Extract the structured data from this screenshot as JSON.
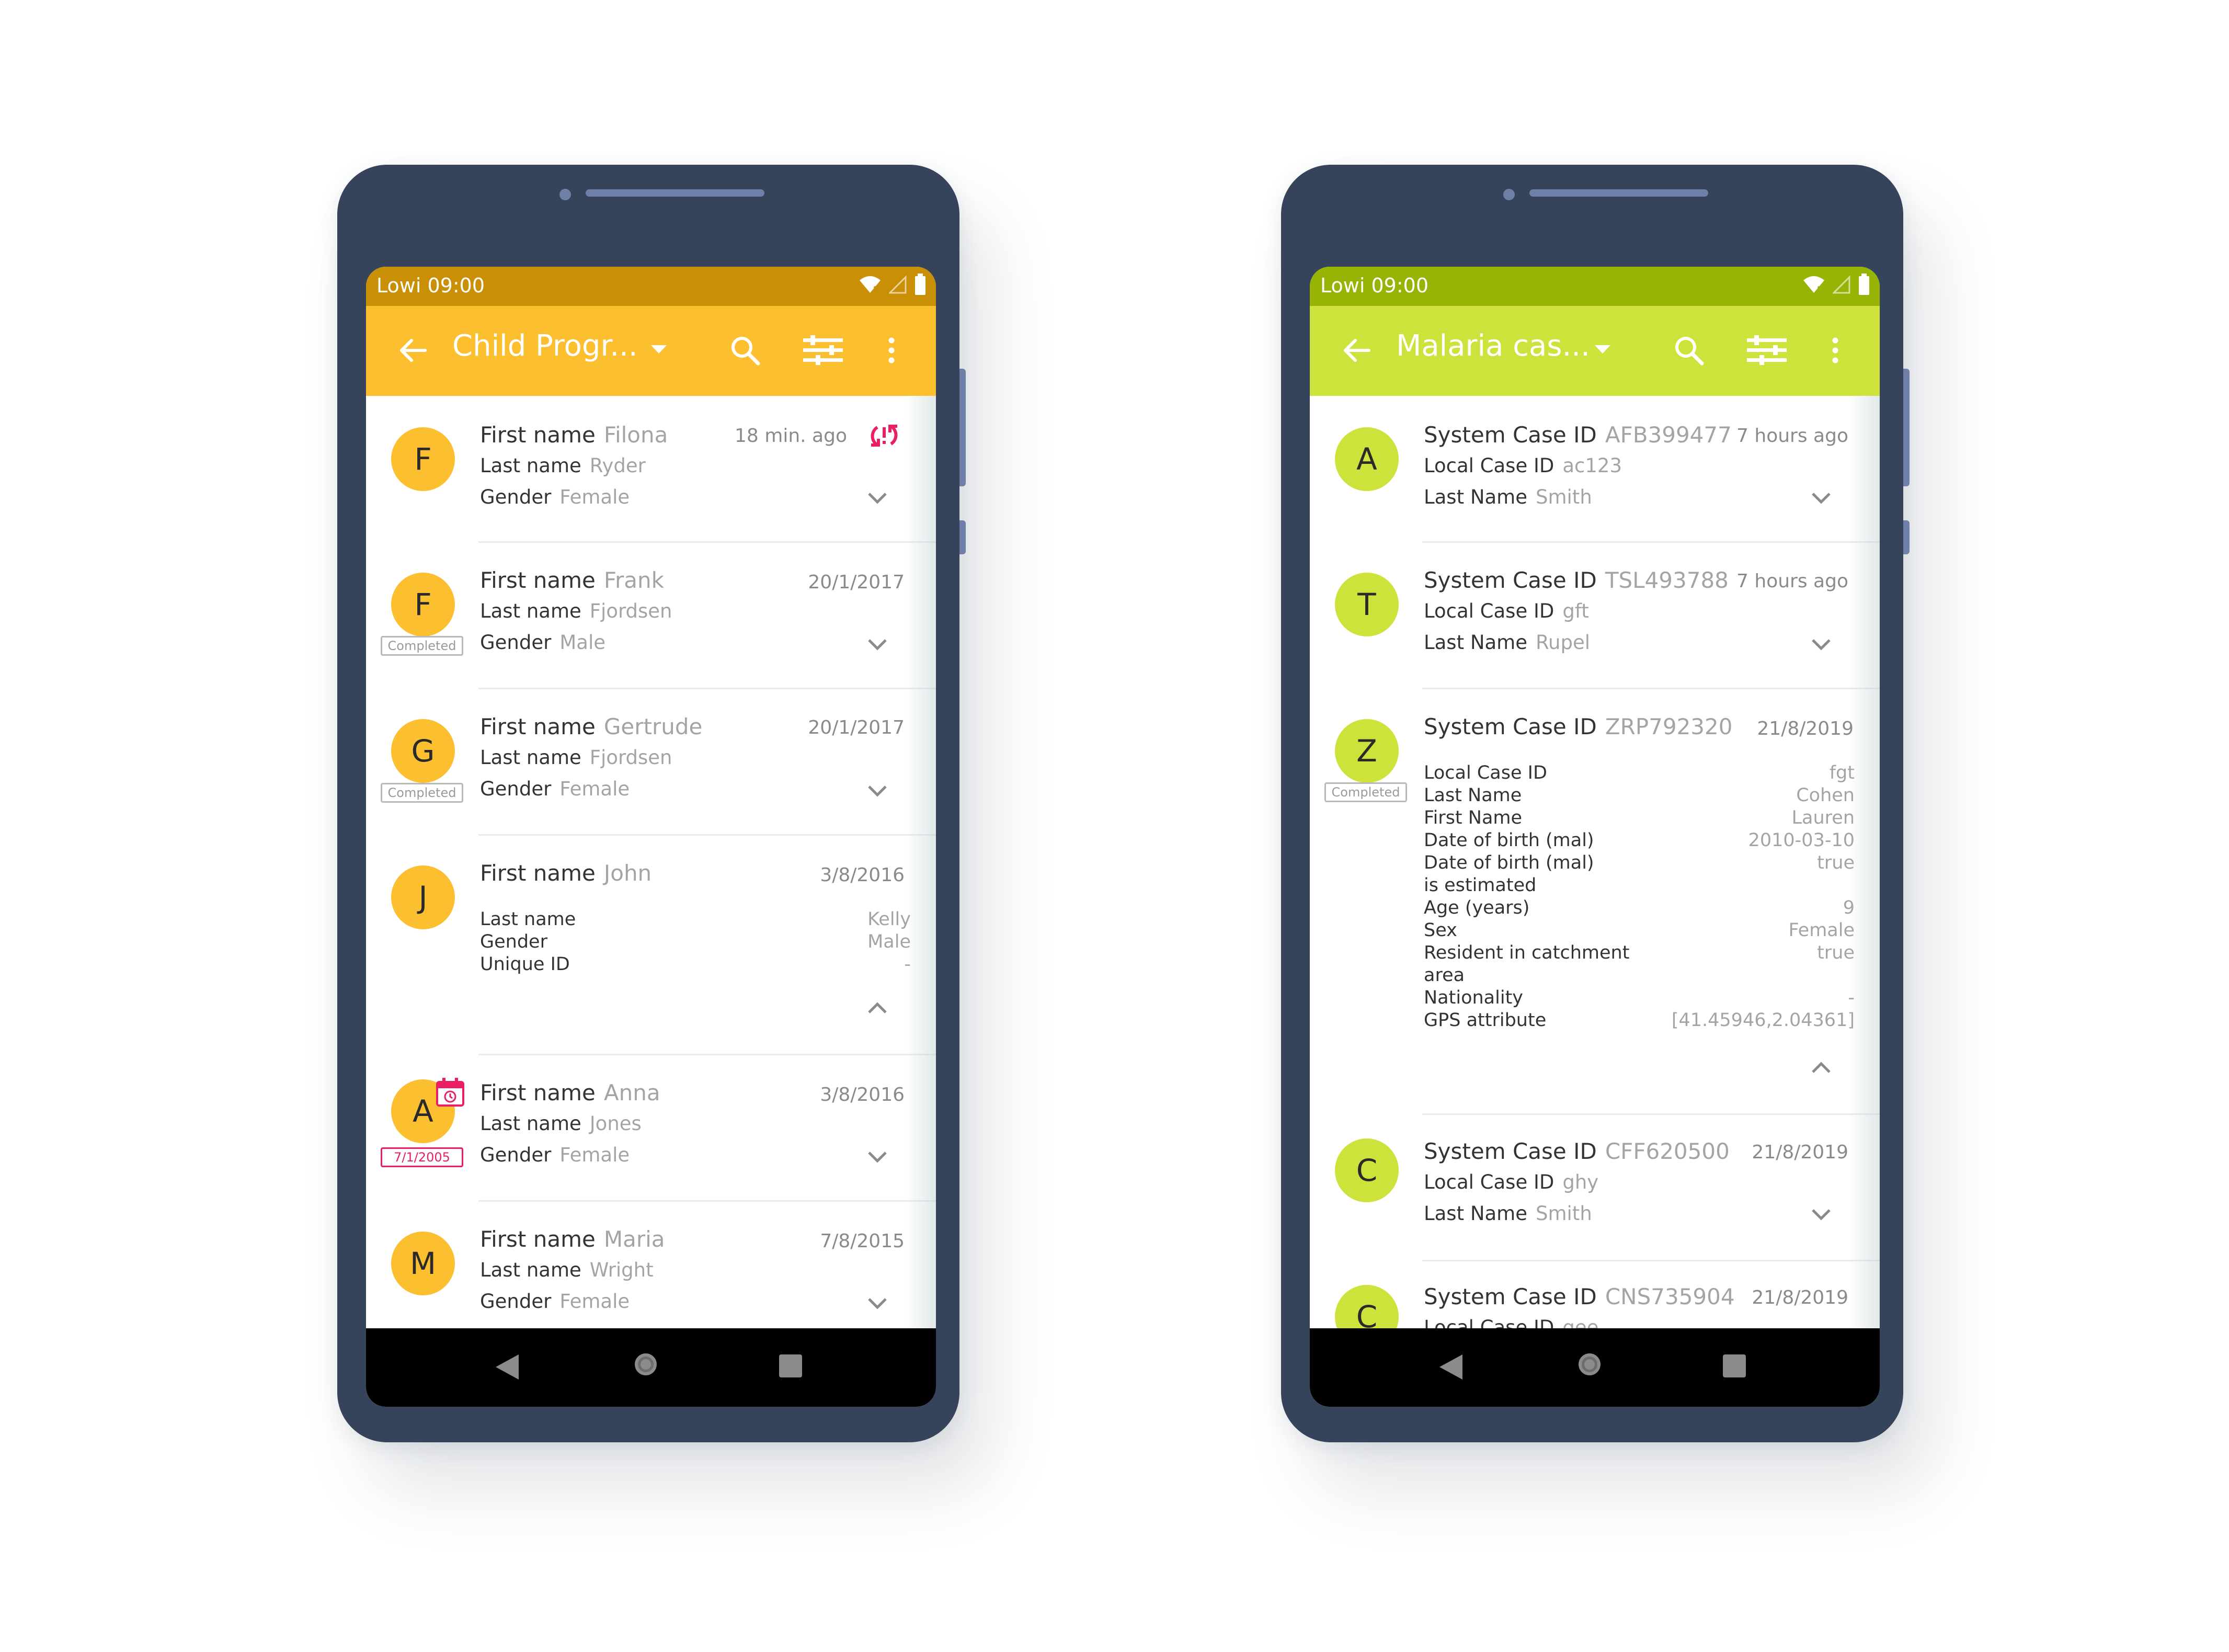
{
  "colors": {
    "left_status": "#c98f05",
    "left_toolbar": "#fbbf30",
    "left_avatar": "#fbbf30",
    "right_status": "#97b405",
    "right_toolbar": "#cde23a",
    "right_avatar": "#cde23a",
    "sync_error": "#e91e63",
    "overdue": "#e91e63"
  },
  "left": {
    "status": {
      "carrier": "Lowi",
      "time": "09:00"
    },
    "toolbar": {
      "title": "Child Progr..."
    },
    "rows": [
      {
        "letter": "F",
        "date": "18 min. ago",
        "sync_error_icon": "sync-error-icon",
        "lines": [
          {
            "label": "First name",
            "value": "Filona"
          },
          {
            "label": "Last name",
            "value": "Ryder"
          },
          {
            "label": "Gender",
            "value": "Female"
          }
        ]
      },
      {
        "letter": "F",
        "badge": "Completed",
        "date": "20/1/2017",
        "lines": [
          {
            "label": "First name",
            "value": "Frank"
          },
          {
            "label": "Last name",
            "value": "Fjordsen"
          },
          {
            "label": "Gender",
            "value": "Male"
          }
        ]
      },
      {
        "letter": "G",
        "badge": "Completed",
        "date": "20/1/2017",
        "lines": [
          {
            "label": "First name",
            "value": "Gertrude"
          },
          {
            "label": "Last name",
            "value": "Fjordsen"
          },
          {
            "label": "Gender",
            "value": "Female"
          }
        ]
      },
      {
        "letter": "J",
        "date": "3/8/2016",
        "lines": [
          {
            "label": "First name",
            "value": "John"
          }
        ],
        "attributes": [
          {
            "label": "Last name",
            "value": "Kelly"
          },
          {
            "label": "Gender",
            "value": "Male"
          },
          {
            "label": "Unique ID",
            "value": "-"
          }
        ]
      },
      {
        "letter": "A",
        "badge": "7/1/2005",
        "date": "3/8/2016",
        "calendar_icon": "calendar-alarm-icon",
        "lines": [
          {
            "label": "First name",
            "value": "Anna"
          },
          {
            "label": "Last name",
            "value": "Jones"
          },
          {
            "label": "Gender",
            "value": "Female"
          }
        ]
      },
      {
        "letter": "M",
        "date": "7/8/2015",
        "lines": [
          {
            "label": "First name",
            "value": "Maria"
          },
          {
            "label": "Last name",
            "value": "Wright"
          },
          {
            "label": "Gender",
            "value": "Female"
          }
        ]
      }
    ]
  },
  "right": {
    "status": {
      "carrier": "Lowi",
      "time": "09:00"
    },
    "toolbar": {
      "title": "Malaria cas..."
    },
    "rows": [
      {
        "letter": "A",
        "date": "7 hours ago",
        "lines": [
          {
            "label": "System Case ID",
            "value": "AFB399477"
          },
          {
            "label": "Local Case ID",
            "value": "ac123"
          },
          {
            "label": "Last Name",
            "value": "Smith"
          }
        ]
      },
      {
        "letter": "T",
        "date": "7 hours ago",
        "lines": [
          {
            "label": "System Case ID",
            "value": "TSL493788"
          },
          {
            "label": "Local Case ID",
            "value": "gft"
          },
          {
            "label": "Last Name",
            "value": "Rupel"
          }
        ]
      },
      {
        "letter": "Z",
        "badge": "Completed",
        "date": "21/8/2019",
        "lines": [
          {
            "label": "System Case ID",
            "value": "ZRP792320"
          }
        ],
        "attributes": [
          {
            "label": "Local Case ID",
            "value": "fgt"
          },
          {
            "label": "Last Name",
            "value": "Cohen"
          },
          {
            "label": "First Name",
            "value": "Lauren"
          },
          {
            "label": "Date of birth (mal)",
            "value": "2010-03-10"
          },
          {
            "label": "Date of birth (mal) is estimated",
            "value": "true"
          },
          {
            "label": "Age (years)",
            "value": "9"
          },
          {
            "label": "Sex",
            "value": "Female"
          },
          {
            "label": "Resident in catchment area",
            "value": "true"
          },
          {
            "label": "Nationality",
            "value": "-"
          },
          {
            "label": "GPS attribute",
            "value": "[41.45946,2.04361]"
          }
        ]
      },
      {
        "letter": "C",
        "date": "21/8/2019",
        "lines": [
          {
            "label": "System Case ID",
            "value": "CFF620500"
          },
          {
            "label": "Local Case ID",
            "value": "ghy"
          },
          {
            "label": "Last Name",
            "value": "Smith"
          }
        ]
      },
      {
        "letter": "C",
        "date": "21/8/2019",
        "lines": [
          {
            "label": "System Case ID",
            "value": "CNS735904"
          },
          {
            "label": "Local Case ID",
            "value": "gee"
          }
        ]
      }
    ]
  }
}
